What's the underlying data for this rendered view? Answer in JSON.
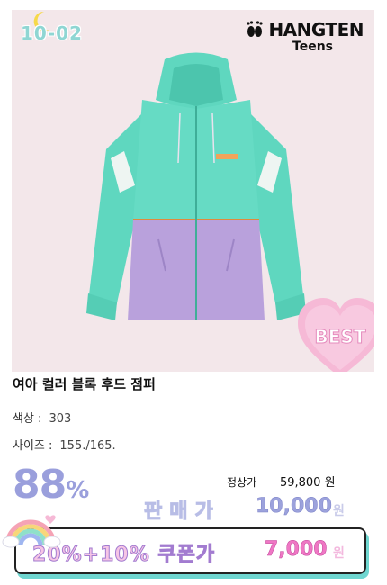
{
  "product": {
    "code": "10-02",
    "brand_name": "HANGTEN",
    "brand_sub": "Teens",
    "badge": "BEST",
    "title": "여아 컬러 블록 후드 점퍼",
    "color_label": "색상 :",
    "color_value": "303",
    "size_label": "사이즈 :",
    "size_value": "155./165."
  },
  "pricing": {
    "discount_number": "88",
    "discount_symbol": "%",
    "regular_label": "정상가",
    "regular_price": "59,800 원",
    "sale_label": "판매가",
    "sale_price": "10,000",
    "sale_unit": "원",
    "coupon_label": "20%+10% 쿠폰가",
    "coupon_price": "7,000",
    "coupon_unit": "원"
  },
  "colors": {
    "background": "#f3e7ea",
    "jacket_top": "#5fd7bf",
    "jacket_bottom": "#b9a1dc",
    "discount": "#9a9fdc",
    "coupon_price": "#ef77c4"
  }
}
